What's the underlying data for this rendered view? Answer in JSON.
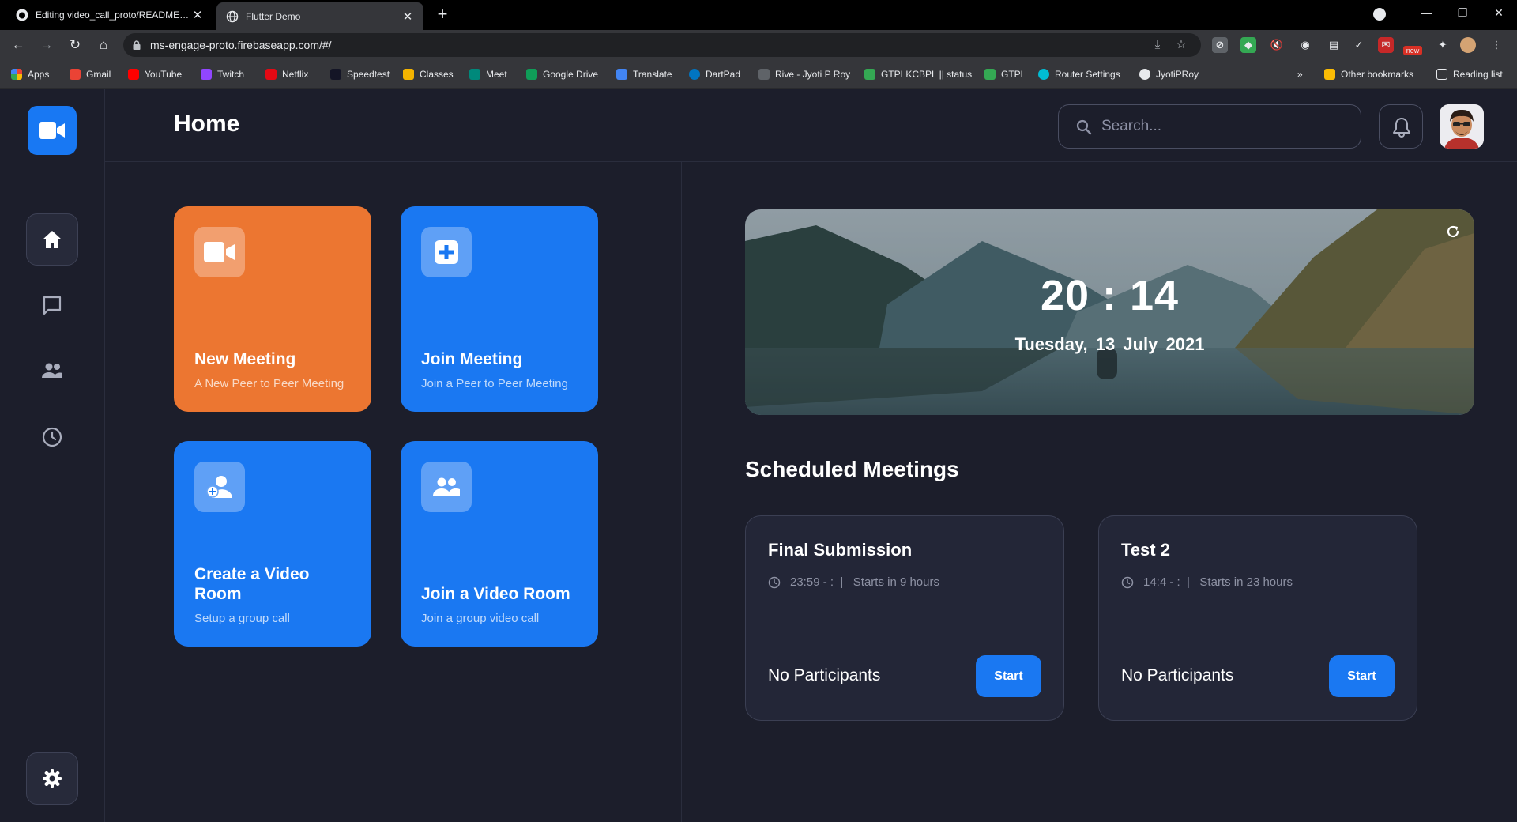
{
  "browser": {
    "tabs": [
      {
        "title": "Editing video_call_proto/README.md",
        "active": false
      },
      {
        "title": "Flutter Demo",
        "active": true
      }
    ],
    "new_tab_label": "+",
    "url": "ms-engage-proto.firebaseapp.com/#/",
    "window_controls": {
      "minimize": "—",
      "maximize": "❐",
      "close": "✕"
    },
    "bookmarks": [
      {
        "label": "Apps",
        "color": "#ea4335"
      },
      {
        "label": "Gmail",
        "color": "#ea4335"
      },
      {
        "label": "YouTube",
        "color": "#ff0000"
      },
      {
        "label": "Twitch",
        "color": "#9146ff"
      },
      {
        "label": "Netflix",
        "color": "#e50914"
      },
      {
        "label": "Speedtest",
        "color": "#141526"
      },
      {
        "label": "Classes",
        "color": "#f4b400"
      },
      {
        "label": "Meet",
        "color": "#00897b"
      },
      {
        "label": "Google Drive",
        "color": "#0f9d58"
      },
      {
        "label": "Translate",
        "color": "#4285f4"
      },
      {
        "label": "DartPad",
        "color": "#0175c2"
      },
      {
        "label": "Rive - Jyoti P Roy",
        "color": "#5f6368"
      },
      {
        "label": "GTPLKCBPL || status",
        "color": "#34a853"
      },
      {
        "label": "GTPL",
        "color": "#34a853"
      },
      {
        "label": "Router Settings",
        "color": "#00bcd4"
      },
      {
        "label": "JyotiPRoy",
        "color": "#e8eaed"
      }
    ],
    "bookmarks_overflow": "»",
    "other_bookmarks": "Other bookmarks",
    "reading_list": "Reading list",
    "extension_badge": "new"
  },
  "app": {
    "page_title": "Home",
    "search_placeholder": "Search...",
    "actions": [
      {
        "title": "New Meeting",
        "subtitle": "A New Peer to Peer Meeting",
        "color": "#ec7631"
      },
      {
        "title": "Join Meeting",
        "subtitle": "Join a Peer to Peer Meeting",
        "color": "#1a78f2"
      },
      {
        "title": "Create a Video Room",
        "subtitle": "Setup a group call",
        "color": "#1a78f2"
      },
      {
        "title": "Join a Video Room",
        "subtitle": "Join a group video call",
        "color": "#1a78f2"
      }
    ],
    "clock": {
      "time": "20 : 14",
      "date": "Tuesday,  13 July 2021"
    },
    "scheduled_title": "Scheduled Meetings",
    "meetings": [
      {
        "title": "Final Submission",
        "meta": "23:59 - :  |   Starts in 9 hours",
        "participants": "No Participants",
        "start_label": "Start"
      },
      {
        "title": "Test 2",
        "meta": "14:4 - :  |   Starts in 23 hours",
        "participants": "No Participants",
        "start_label": "Start"
      }
    ]
  }
}
